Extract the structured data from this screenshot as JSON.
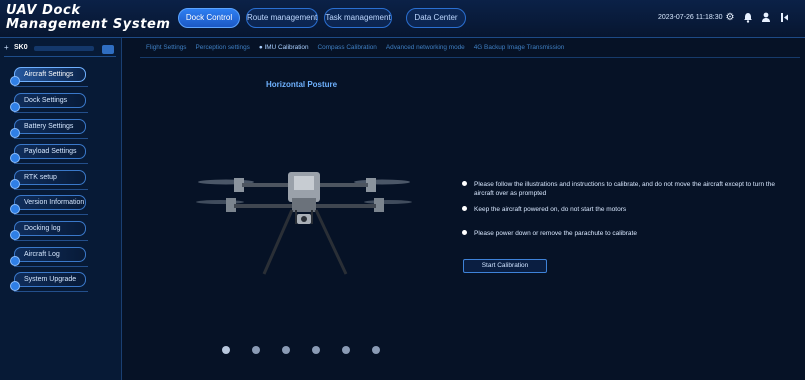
{
  "header": {
    "title": "UAV Dock Management System",
    "nav": [
      "Dock Control",
      "Route management",
      "Task management",
      "Data Center"
    ],
    "active_nav": 0,
    "datetime": "2023-07-26 11:18:30",
    "icons": [
      "gear-icon",
      "bell-icon",
      "user-icon",
      "logout-icon"
    ]
  },
  "sidebar": {
    "dock_name": "SK0",
    "items": [
      {
        "label": "Aircraft Settings",
        "active": true
      },
      {
        "label": "Dock Settings"
      },
      {
        "label": "Battery Settings"
      },
      {
        "label": "Payload Settings"
      },
      {
        "label": "RTK setup"
      },
      {
        "label": "Version Information"
      },
      {
        "label": "Docking log"
      },
      {
        "label": "Aircraft Log"
      },
      {
        "label": "System Upgrade"
      }
    ]
  },
  "subtabs": {
    "items": [
      "Flight Settings",
      "Perception settings",
      "IMU Calibration",
      "Compass Calibration",
      "Advanced networking mode",
      "4G Backup Image Transmission"
    ],
    "active": 2
  },
  "main": {
    "section_title": "Horizontal Posture",
    "instructions": [
      "Please follow the illustrations and instructions to calibrate, and do not move the aircraft except to turn the aircraft over as prompted",
      "Keep the aircraft powered on, do not start the motors",
      "Please power down or remove the parachute to calibrate"
    ],
    "start_button": "Start Calibration",
    "carousel_count": 6,
    "carousel_active": 0
  },
  "colors": {
    "background": "#061226",
    "accent": "#2e7ff2",
    "title_blue": "#6fb2ff"
  }
}
